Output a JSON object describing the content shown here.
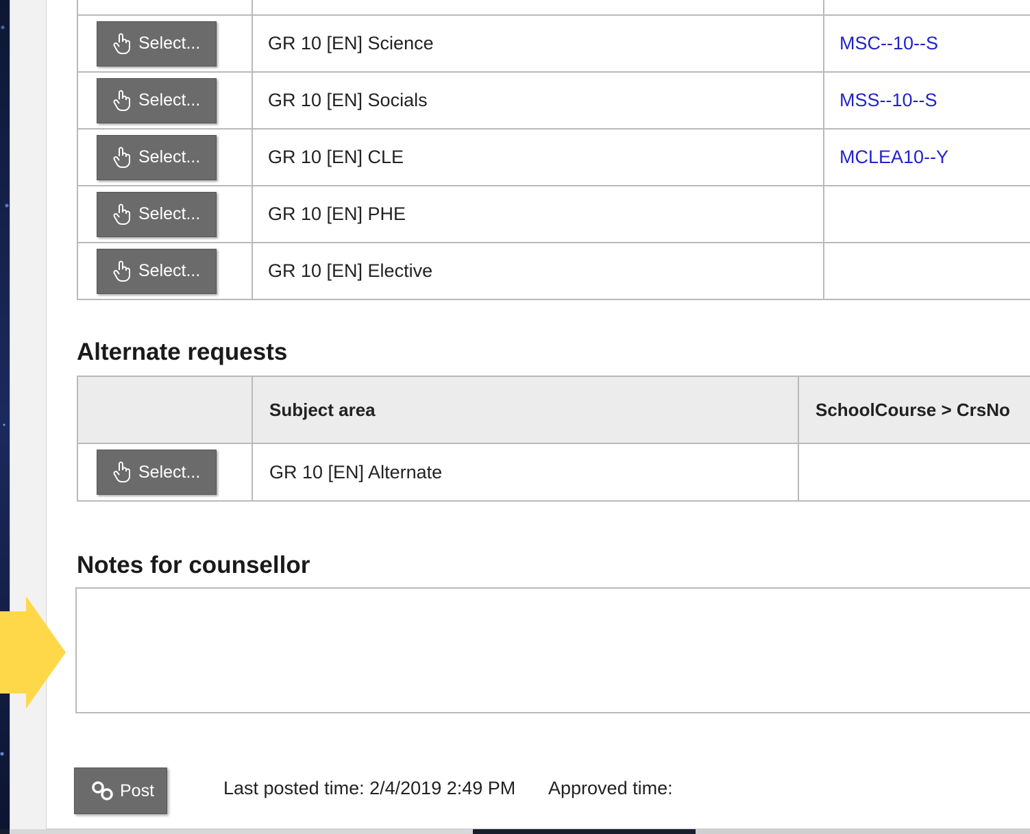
{
  "requests": {
    "rows": [
      {
        "button": "Select...",
        "subject": "GR 10 [EN] Science",
        "code": "MSC--10--S"
      },
      {
        "button": "Select...",
        "subject": "GR 10 [EN] Socials",
        "code": "MSS--10--S"
      },
      {
        "button": "Select...",
        "subject": "GR 10 [EN] CLE",
        "code": "MCLEA10--Y"
      },
      {
        "button": "Select...",
        "subject": "GR 10 [EN] PHE",
        "code": ""
      },
      {
        "button": "Select...",
        "subject": "GR 10 [EN] Elective",
        "code": ""
      }
    ]
  },
  "alternate": {
    "heading": "Alternate requests",
    "columns": [
      "",
      "Subject area",
      "SchoolCourse > CrsNo"
    ],
    "rows": [
      {
        "button": "Select...",
        "subject": "GR 10 [EN] Alternate",
        "code": ""
      }
    ]
  },
  "notes": {
    "heading": "Notes for counsellor",
    "value": ""
  },
  "footer": {
    "post_label": "Post",
    "last_posted": "Last posted time: 2/4/2019 2:49 PM",
    "approved": "Approved time:"
  },
  "colors": {
    "link": "#2222cc",
    "button_bg": "#6b6b6b",
    "arrow": "#ffd84a"
  },
  "icons": {
    "select": "pointing-hand-icon",
    "post": "link-icon",
    "arrow": "arrow-right-icon"
  }
}
